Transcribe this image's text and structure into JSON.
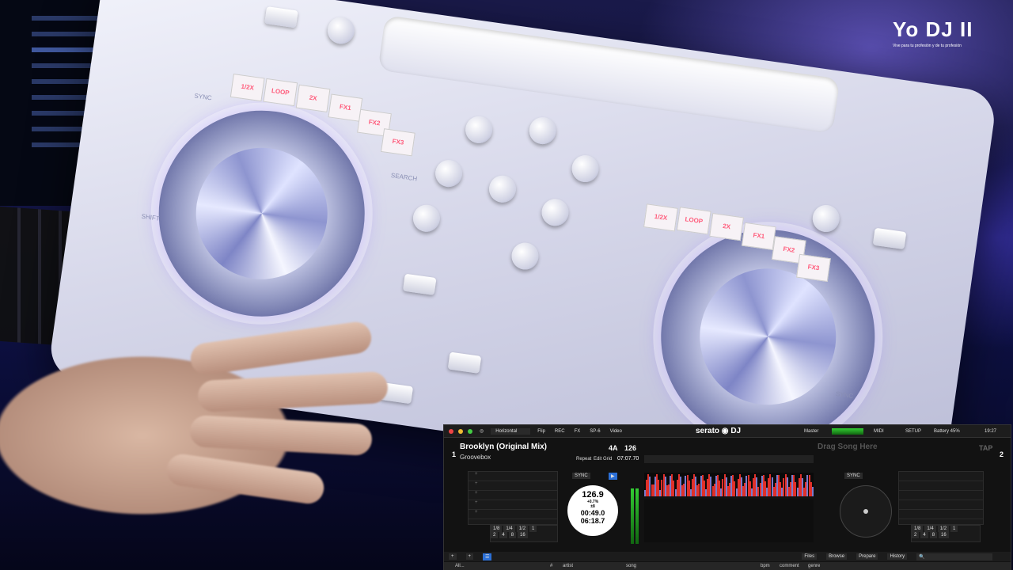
{
  "watermark": {
    "logo": "Yo DJ II",
    "tagline": "Vive para tu profesión y de tu profesión"
  },
  "controller": {
    "pads_left": [
      "1/2X",
      "LOOP",
      "2X",
      "FX1",
      "FX2",
      "FX3"
    ],
    "pads_right": [
      "1/2X",
      "LOOP",
      "2X",
      "FX1",
      "FX2",
      "FX3"
    ],
    "sync_label": "SYNC",
    "search_label": "SEARCH",
    "shift_label": "SHIFT"
  },
  "serato": {
    "layout_select": "Horizontal",
    "toolbar_buttons": [
      "Flip",
      "REC",
      "FX",
      "SP-6",
      "Video"
    ],
    "brand": "serato",
    "brand_suffix": "DJ",
    "master_label": "Master",
    "midi_label": "MIDI",
    "setup_label": "SETUP",
    "battery": "Battery 45%",
    "clock": "19:27",
    "deck1": {
      "number": "1",
      "title": "Brooklyn (Original Mix)",
      "artist": "Groovebox",
      "key": "4A",
      "bpm": "126",
      "repeat": "Repeat",
      "edit_grid": "Edit Grid",
      "total_time": "07:07.70",
      "platter_bpm": "126.9",
      "pitch": "+0.7%",
      "pitch_range": "±8",
      "elapsed": "00:49.0",
      "remaining": "06:18.7",
      "sync": "SYNC",
      "loop_values": [
        "1/8",
        "1/4",
        "1/2",
        "1"
      ],
      "loop_values2": [
        "2",
        "4",
        "8",
        "16"
      ]
    },
    "deck2": {
      "number": "2",
      "placeholder": "Drag Song Here",
      "tap": "TAP",
      "sync": "SYNC",
      "loop_values": [
        "1/8",
        "1/4",
        "1/2",
        "1"
      ],
      "loop_values2": [
        "2",
        "4",
        "8",
        "16"
      ]
    },
    "footer_buttons": [
      "Files",
      "Browse",
      "Prepare",
      "History"
    ],
    "library": {
      "crate": "All...",
      "columns": [
        "#",
        "artist",
        "song",
        "bpm",
        "comment",
        "genre"
      ]
    },
    "colors": {
      "accent_blue": "#2b6fd6",
      "wave_red": "#e0302a"
    }
  }
}
